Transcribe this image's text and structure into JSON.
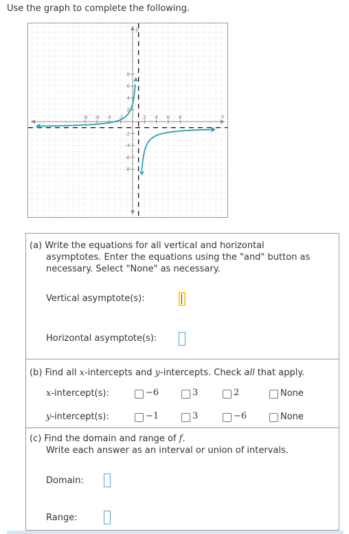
{
  "prompt": "Use the graph to complete the following.",
  "graph": {
    "x_label": "x",
    "y_label": "y",
    "x_ticks": [
      "-8",
      "-6",
      "-4",
      "-2",
      "2",
      "4",
      "6",
      "8"
    ],
    "y_ticks": [
      "8",
      "6",
      "4",
      "2",
      "-2",
      "-4",
      "-6",
      "-8"
    ],
    "vertical_asymptote_x": 1,
    "horizontal_asymptote_y": -1,
    "curve_color": "#2a9bb5",
    "asymptote_color": "#1a1a1a"
  },
  "part_a": {
    "line1": "(a) Write the equations for all vertical and horizontal",
    "line2": "asymptotes. Enter the equations using the \"and\" button as",
    "line3": "necessary. Select \"None\" as necessary.",
    "vertical_label": "Vertical asymptote(s):",
    "horizontal_label": "Horizontal asymptote(s):"
  },
  "part_b": {
    "text_pre": "(b) Find all ",
    "x_var": "x",
    "text_mid1": "-intercepts and ",
    "y_var": "y",
    "text_mid2": "-intercepts. Check ",
    "all": "all",
    "text_end": " that apply.",
    "x_intercept_label": "-intercept(s):",
    "y_intercept_label": "-intercept(s):",
    "x_options": [
      "−6",
      "3",
      "2",
      "None"
    ],
    "y_options": [
      "−1",
      "3",
      "−6",
      "None"
    ]
  },
  "part_c": {
    "line1_pre": "(c) Find the domain and range of ",
    "f": "f",
    "line1_end": ".",
    "line2": "Write each answer as an interval or union of intervals.",
    "domain_label": "Domain:",
    "range_label": "Range:"
  }
}
